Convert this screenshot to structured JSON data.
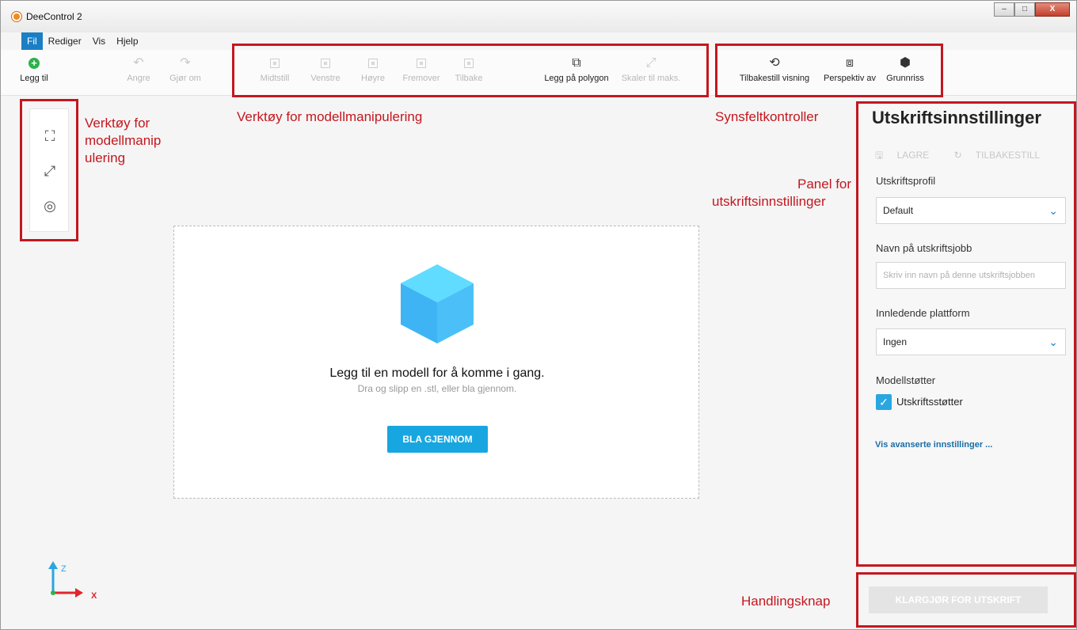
{
  "window": {
    "title": "DeeControl 2",
    "controls": {
      "minimize": "–",
      "maximize": "□",
      "close": "X"
    }
  },
  "menu": {
    "items": [
      "Fil",
      "Rediger",
      "Vis",
      "Hjelp"
    ]
  },
  "toolbar": {
    "add": "Legg til",
    "undo": "Angre",
    "redo": "Gjør om",
    "center": "Midtstill",
    "left": "Venstre",
    "right": "Høyre",
    "forward": "Fremover",
    "back": "Tilbake",
    "lay_on_polygon": "Legg på polygon",
    "scale_max": "Skaler til maks.",
    "reset_view": "Tilbakestill visning",
    "perspective": "Perspektiv av",
    "floor_plan": "Grunnriss"
  },
  "annotations": {
    "toolbar_manip": "Verktøy for modellmanipulering",
    "left_manip_1": "Verktøy for",
    "left_manip_2": "modellmanip",
    "left_manip_3": "ulering",
    "view_controls": "Synsfeltkontroller",
    "panel_1": "Panel for",
    "panel_2": "utskriftsinnstillinger",
    "action_button": "Handlingsknap"
  },
  "dropzone": {
    "title": "Legg til en modell for å komme i gang.",
    "subtitle": "Dra og slipp en .stl, eller bla gjennom.",
    "browse_button": "BLA GJENNOM"
  },
  "settings": {
    "title": "Utskriftsinnstillinger",
    "save": "LAGRE",
    "reset": "TILBAKESTILL",
    "profile_label": "Utskriftsprofil",
    "profile_value": "Default",
    "job_name_label": "Navn på utskriftsjobb",
    "job_name_placeholder": "Skriv inn navn på denne utskriftsjobben",
    "platform_label": "Innledende plattform",
    "platform_value": "Ingen",
    "supports_label": "Modellstøtter",
    "supports_checkbox": "Utskriftsstøtter",
    "supports_checked": true,
    "advanced_link": "Vis avanserte innstillinger ..."
  },
  "action": {
    "prepare_button": "KLARGJØR FOR UTSKRIFT"
  },
  "axis": {
    "z": "Z",
    "x": "X"
  },
  "colors": {
    "accent": "#18a6e0",
    "annotation": "#c4171f",
    "menu_active": "#1a7fc4",
    "add": "#2bb24c"
  }
}
